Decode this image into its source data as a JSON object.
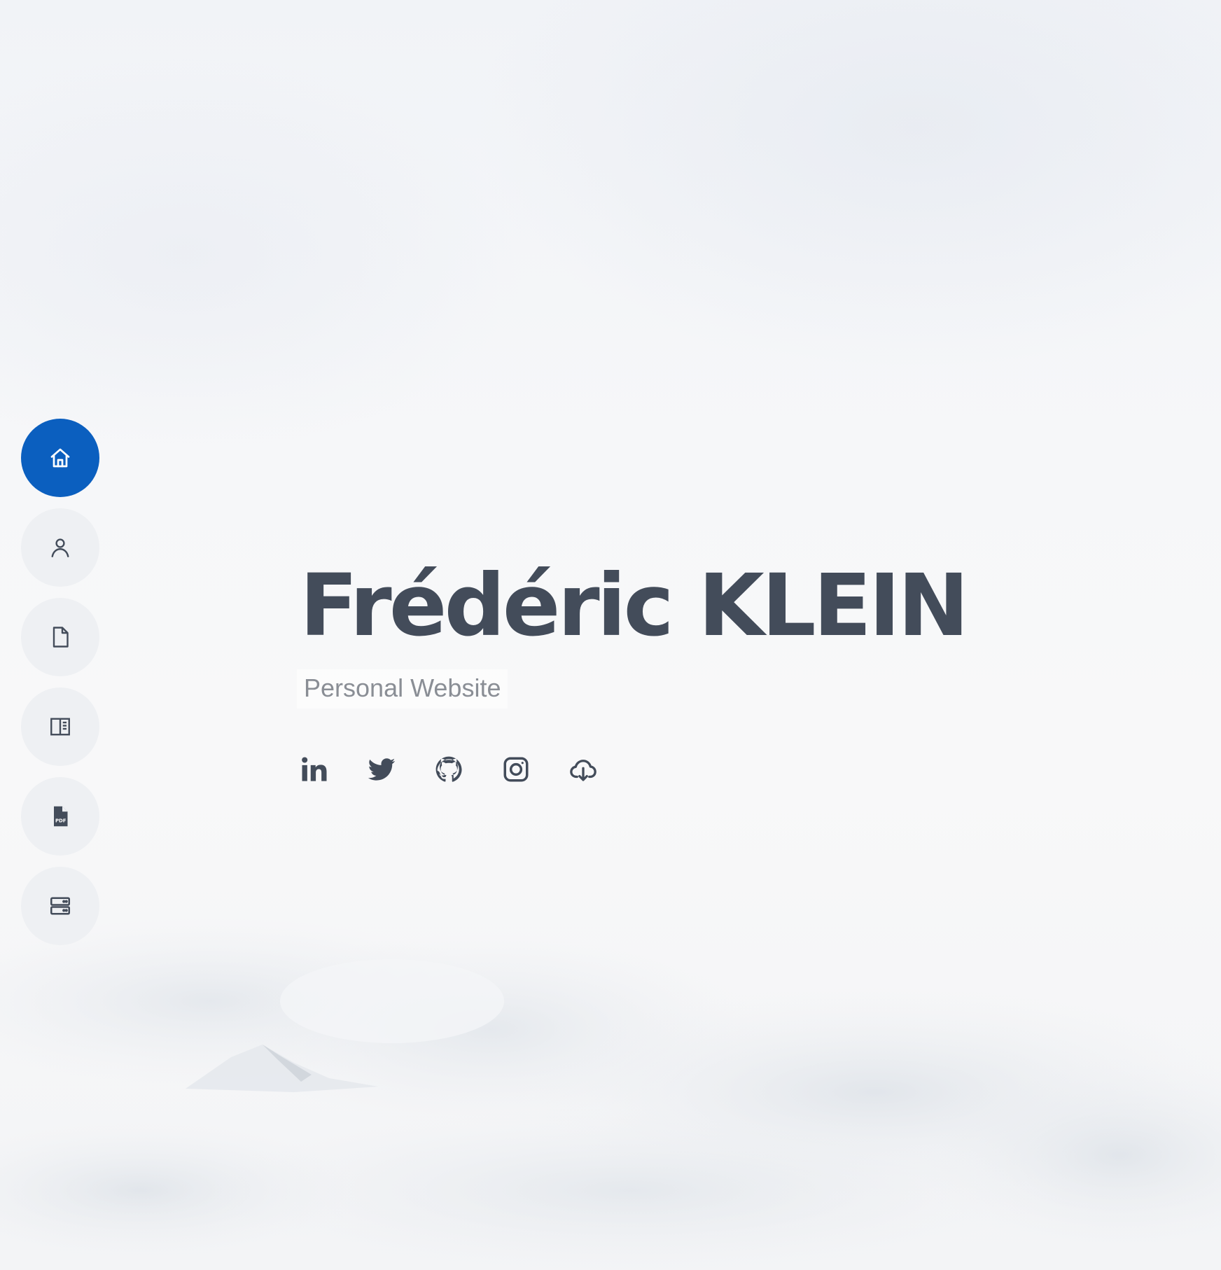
{
  "hero": {
    "name": "Frédéric KLEIN",
    "subtitle": "Personal Website"
  },
  "sidebar": {
    "items": [
      {
        "icon": "home-icon",
        "active": true
      },
      {
        "icon": "user-icon",
        "active": false
      },
      {
        "icon": "document-icon",
        "active": false
      },
      {
        "icon": "book-panel-icon",
        "active": false
      },
      {
        "icon": "pdf-file-icon",
        "active": false
      },
      {
        "icon": "server-icon",
        "active": false
      }
    ]
  },
  "socials": [
    {
      "icon": "linkedin-icon"
    },
    {
      "icon": "twitter-icon"
    },
    {
      "icon": "github-icon"
    },
    {
      "icon": "instagram-icon"
    },
    {
      "icon": "cloud-download-icon"
    }
  ],
  "colors": {
    "accent": "#0b5fbf",
    "text_dark": "#434c5a",
    "text_muted": "#8a8e95",
    "nav_bg": "#eef0f3"
  }
}
